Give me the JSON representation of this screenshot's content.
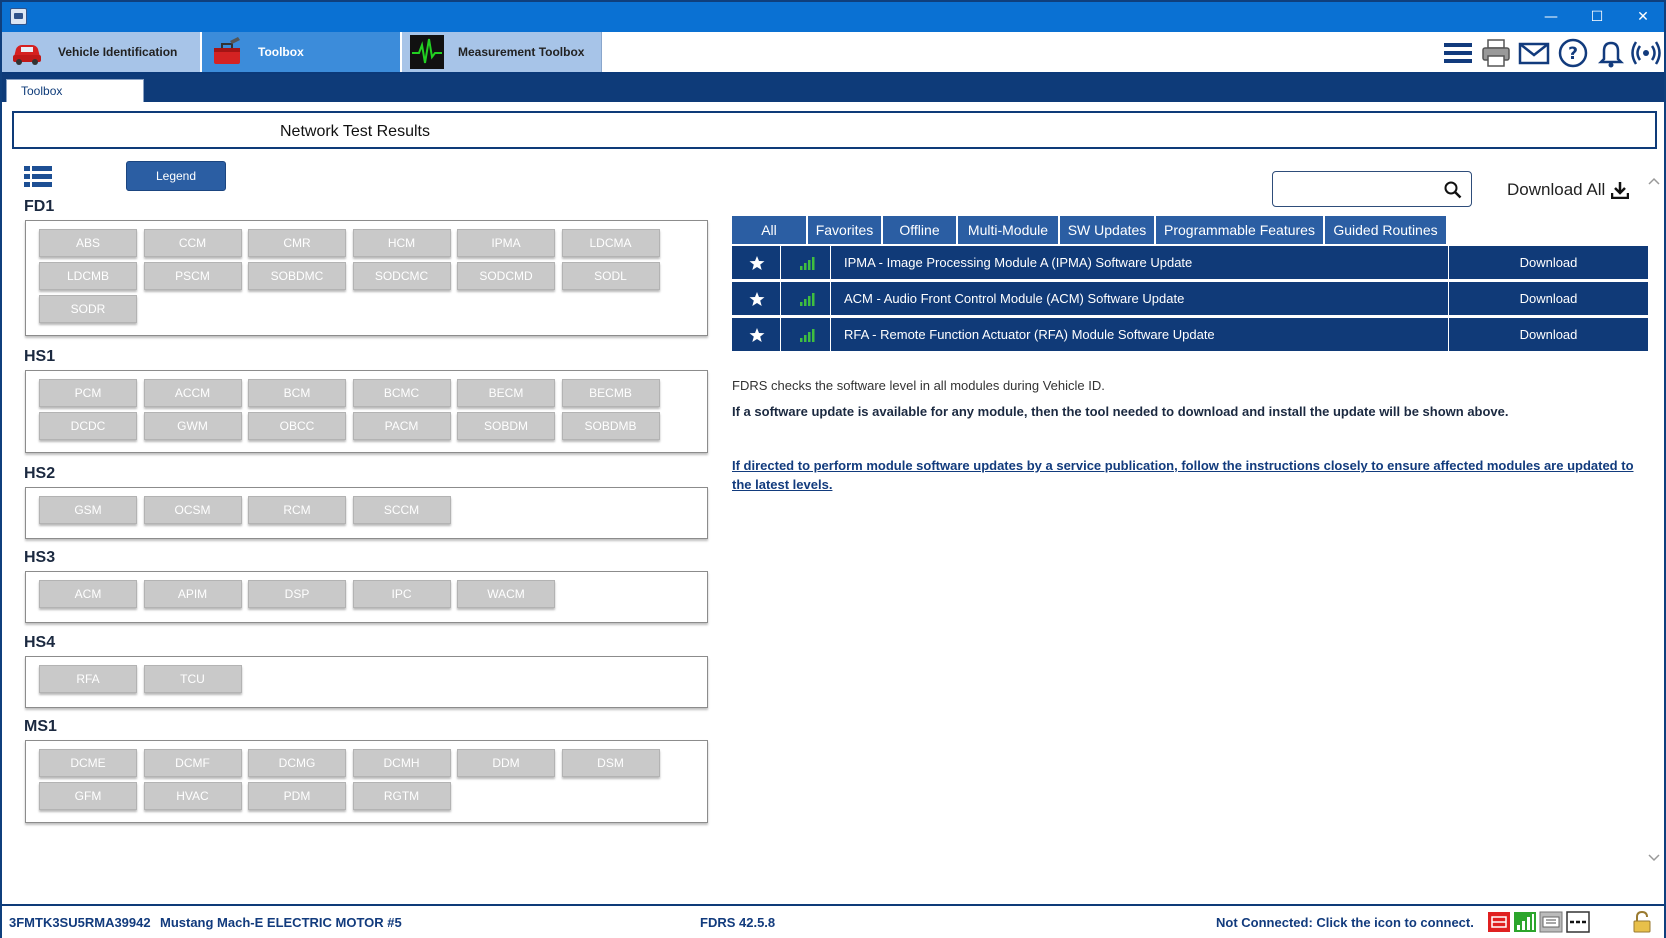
{
  "window": {
    "icon": "fdrs-app-icon",
    "controls": {
      "minimize": "—",
      "maximize": "☐",
      "close": "✕"
    }
  },
  "top_nav": {
    "tabs": [
      {
        "label": "Vehicle Identification",
        "icon": "car-icon"
      },
      {
        "label": "Toolbox",
        "icon": "toolbox-icon",
        "active": true
      },
      {
        "label": "Measurement Toolbox",
        "icon": "waveform-icon"
      }
    ],
    "tools": [
      "menu-icon",
      "printer-icon",
      "mail-icon",
      "help-icon",
      "bell-icon",
      "signal-broadcast-icon"
    ]
  },
  "sub_tab": {
    "label": "Toolbox"
  },
  "page_title": "Network Test Results",
  "left_panel": {
    "legend_label": "Legend",
    "buses": [
      {
        "name": "FD1",
        "modules": [
          "ABS",
          "CCM",
          "CMR",
          "HCM",
          "IPMA",
          "LDCMA",
          "LDCMB",
          "PSCM",
          "SOBDMC",
          "SODCMC",
          "SODCMD",
          "SODL",
          "SODR"
        ]
      },
      {
        "name": "HS1",
        "modules": [
          "PCM",
          "ACCM",
          "BCM",
          "BCMC",
          "BECM",
          "BECMB",
          "DCDC",
          "GWM",
          "OBCC",
          "PACM",
          "SOBDM",
          "SOBDMB"
        ]
      },
      {
        "name": "HS2",
        "modules": [
          "GSM",
          "OCSM",
          "RCM",
          "SCCM"
        ]
      },
      {
        "name": "HS3",
        "modules": [
          "ACM",
          "APIM",
          "DSP",
          "IPC",
          "WACM"
        ]
      },
      {
        "name": "HS4",
        "modules": [
          "RFA",
          "TCU"
        ]
      },
      {
        "name": "MS1",
        "modules": [
          "DCME",
          "DCMF",
          "DCMG",
          "DCMH",
          "DDM",
          "DSM",
          "GFM",
          "HVAC",
          "PDM",
          "RGTM"
        ]
      }
    ]
  },
  "right_panel": {
    "search": {
      "value": "",
      "placeholder": ""
    },
    "download_all_label": "Download All",
    "filter_tabs": [
      "All",
      "Favorites",
      "Offline",
      "Multi-Module",
      "SW Updates",
      "Programmable Features",
      "Guided Routines"
    ],
    "updates": [
      {
        "title": "IPMA - Image Processing Module A (IPMA) Software Update",
        "action": "Download"
      },
      {
        "title": "ACM - Audio Front Control Module (ACM) Software Update",
        "action": "Download"
      },
      {
        "title": "RFA - Remote Function Actuator (RFA) Module Software Update",
        "action": "Download"
      }
    ],
    "info_text_1": "FDRS checks the software level in all modules during Vehicle ID.",
    "info_text_2": "If a software update is available for any module, then the tool needed to download and install the update will be shown above.",
    "info_link": "If directed to perform module software updates by a service publication, follow the instructions closely to ensure affected modules are updated to the latest levels."
  },
  "status_bar": {
    "vin": "3FMTK3SU5RMA39942",
    "vehicle": "Mustang Mach-E ELECTRIC MOTOR #5",
    "version": "FDRS 42.5.8",
    "connection": "Not Connected: Click the icon to connect."
  },
  "colors": {
    "title_bar": "#0a71d3",
    "navy": "#103a78",
    "tab_blue": "#2b5ea3",
    "module_grey": "#c9c9c9",
    "signal_green": "#3fbf3f"
  }
}
